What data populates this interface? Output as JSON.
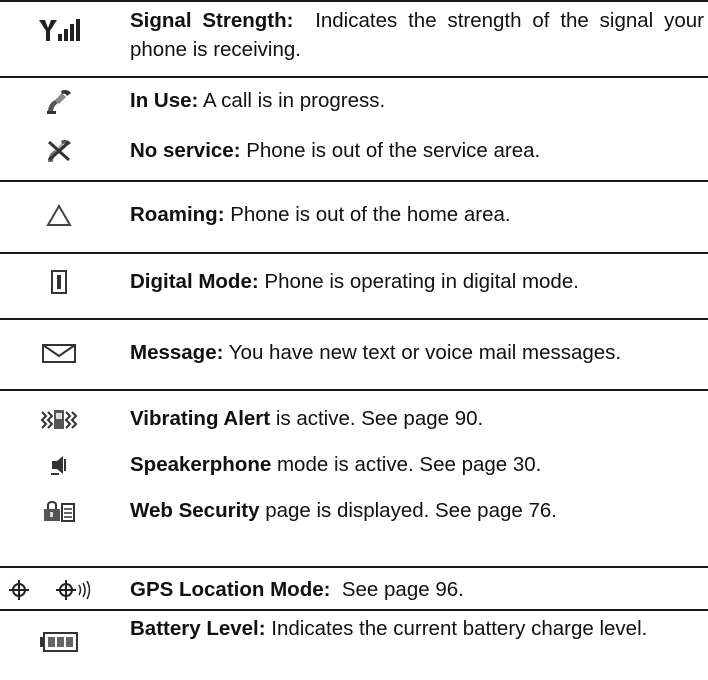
{
  "entries": [
    {
      "icon": "signal-strength-icon",
      "term": "Signal Strength:",
      "description": "Indicates the strength of the signal your phone is receiving."
    },
    {
      "icon": "in-use-icon",
      "term": "In Use:",
      "description": "A call is in progress."
    },
    {
      "icon": "no-service-icon",
      "term": "No service:",
      "description": "Phone is out of the service area."
    },
    {
      "icon": "roaming-icon",
      "term": "Roaming:",
      "description": "Phone is out of the home area."
    },
    {
      "icon": "digital-mode-icon",
      "term": "Digital Mode:",
      "description": "Phone is operating in digital mode."
    },
    {
      "icon": "message-envelope-icon",
      "term": "Message:",
      "description": "You have new text or voice mail messages."
    },
    {
      "icon": "vibrating-alert-icon",
      "term": "Vibrating Alert",
      "description": "is active. See page 90."
    },
    {
      "icon": "speakerphone-icon",
      "term": "Speakerphone",
      "description": "mode is active. See page 30."
    },
    {
      "icon": "web-security-icon",
      "term": "Web Security",
      "description": "page is displayed. See page 76."
    },
    {
      "icon": "gps-location-icon",
      "term": "GPS Location Mode:",
      "description": "See page 96."
    },
    {
      "icon": "battery-level-icon",
      "term": "Battery Level:",
      "description": "Indicates the current battery charge level."
    }
  ]
}
